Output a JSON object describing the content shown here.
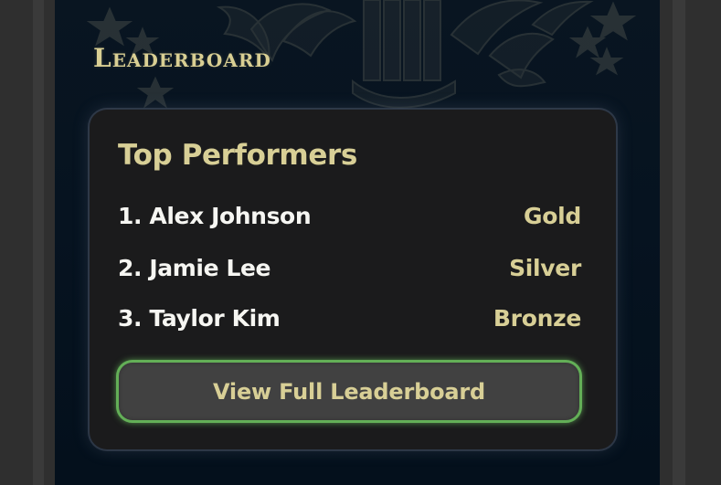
{
  "colors": {
    "page_background": "#2f2f2f",
    "panel_background": "#061320",
    "gold_text": "#d8cf96",
    "white_text": "#f6f6f2",
    "card_background": "#1b1b1c",
    "button_background": "#414141",
    "button_border": "#63af57"
  },
  "background": {
    "emblem": "decorative seal with eagle and stars"
  },
  "section": {
    "title": "Leaderboard"
  },
  "card": {
    "title": "Top Performers",
    "entries": [
      {
        "rank_name": "1. Alex Johnson",
        "medal": "Gold"
      },
      {
        "rank_name": "2. Jamie Lee",
        "medal": "Silver"
      },
      {
        "rank_name": "3. Taylor Kim",
        "medal": "Bronze"
      }
    ],
    "button_label": "View Full Leaderboard"
  }
}
